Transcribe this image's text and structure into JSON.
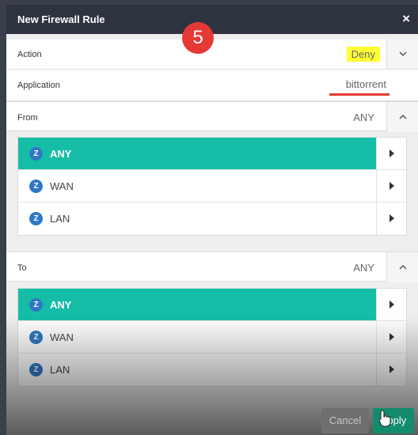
{
  "dialog": {
    "title": "New Firewall Rule",
    "close": "×"
  },
  "badge": {
    "number": "5"
  },
  "action": {
    "label": "Action",
    "value": "Deny"
  },
  "application": {
    "label": "Application",
    "value": "bittorrent"
  },
  "from": {
    "label": "From",
    "value": "ANY",
    "items": [
      {
        "icon": "Z",
        "name": "ANY",
        "selected": true
      },
      {
        "icon": "Z",
        "name": "WAN",
        "selected": false
      },
      {
        "icon": "Z",
        "name": "LAN",
        "selected": false
      }
    ]
  },
  "to": {
    "label": "To",
    "value": "ANY",
    "items": [
      {
        "icon": "Z",
        "name": "ANY",
        "selected": true
      },
      {
        "icon": "Z",
        "name": "WAN",
        "selected": false
      },
      {
        "icon": "Z",
        "name": "LAN",
        "selected": false
      }
    ]
  },
  "footer": {
    "cancel": "Cancel",
    "apply": "Apply"
  },
  "colors": {
    "titlebar": "#2e3340",
    "selected": "#16bda6",
    "zone_icon": "#2f78c4",
    "badge": "#e53935",
    "highlight": "#ffff33",
    "apply": "#128c6c"
  }
}
